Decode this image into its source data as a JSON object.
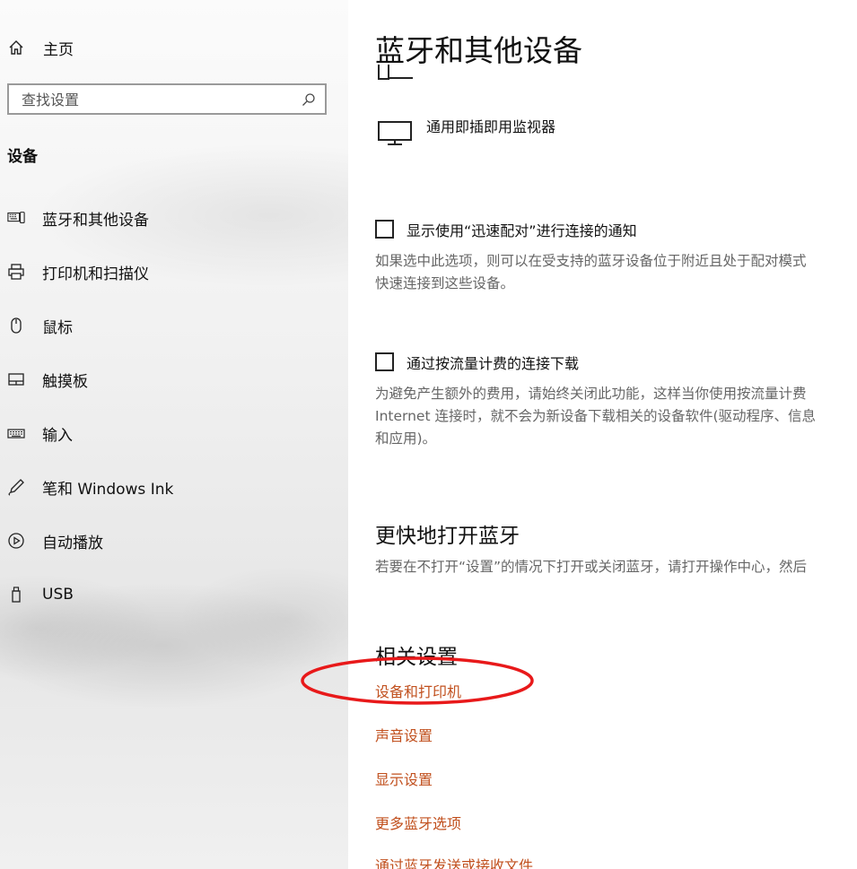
{
  "sidebar": {
    "home_label": "主页",
    "search_placeholder": "查找设置",
    "section_heading": "设备",
    "items": [
      {
        "label": "蓝牙和其他设备",
        "icon": "bluetooth-devices-icon"
      },
      {
        "label": "打印机和扫描仪",
        "icon": "printer-icon"
      },
      {
        "label": "鼠标",
        "icon": "mouse-icon"
      },
      {
        "label": "触摸板",
        "icon": "touchpad-icon"
      },
      {
        "label": "输入",
        "icon": "keyboard-icon"
      },
      {
        "label": "笔和 Windows Ink",
        "icon": "pen-icon"
      },
      {
        "label": "自动播放",
        "icon": "autoplay-icon"
      },
      {
        "label": "USB",
        "icon": "usb-icon"
      }
    ]
  },
  "main": {
    "title": "蓝牙和其他设备",
    "monitor_device": "通用即插即用监视器",
    "swift_pair": {
      "label": "显示使用“迅速配对”进行连接的通知",
      "checked": false,
      "description_line1": "如果选中此选项，则可以在受支持的蓝牙设备位于附近且处于配对模式",
      "description_line2": "快速连接到这些设备。"
    },
    "metered": {
      "label": "通过按流量计费的连接下载",
      "checked": false,
      "description_line1": "为避免产生额外的费用，请始终关闭此功能，这样当你使用按流量计费",
      "description_line2": "Internet 连接时，就不会为新设备下载相关的设备软件(驱动程序、信息",
      "description_line3": "和应用)。"
    },
    "quick_bluetooth": {
      "heading": "更快地打开蓝牙",
      "description": "若要在不打开“设置”的情况下打开或关闭蓝牙，请打开操作中心，然后"
    },
    "related": {
      "heading": "相关设置",
      "links": [
        "设备和打印机",
        "声音设置",
        "显示设置",
        "更多蓝牙选项",
        "通过蓝牙发送或接收文件"
      ]
    }
  },
  "colors": {
    "link": "#c1501e",
    "annotation": "#e8191a",
    "sidebar_bg": "#efefef"
  }
}
